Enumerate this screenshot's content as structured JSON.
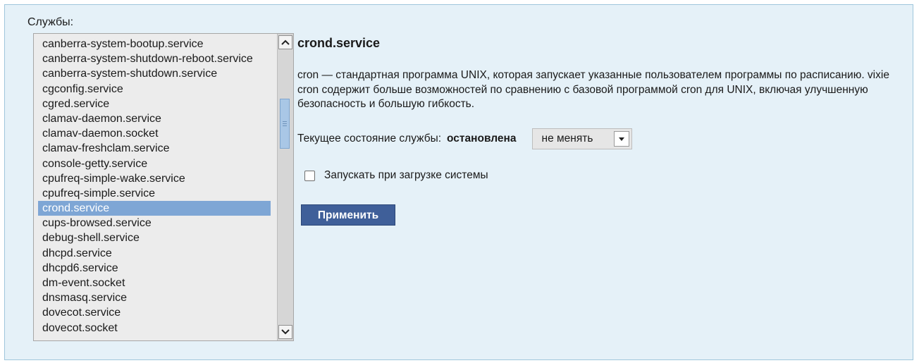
{
  "services_label": "Службы:",
  "services": [
    "canberra-system-bootup.service",
    "canberra-system-shutdown-reboot.service",
    "canberra-system-shutdown.service",
    "cgconfig.service",
    "cgred.service",
    "clamav-daemon.service",
    "clamav-daemon.socket",
    "clamav-freshclam.service",
    "console-getty.service",
    "cpufreq-simple-wake.service",
    "cpufreq-simple.service",
    "crond.service",
    "cups-browsed.service",
    "debug-shell.service",
    "dhcpd.service",
    "dhcpd6.service",
    "dm-event.socket",
    "dnsmasq.service",
    "dovecot.service",
    "dovecot.socket"
  ],
  "selected_service_index": 11,
  "detail": {
    "title": "crond.service",
    "description": "cron — стандартная программа UNIX, которая запускает указанные пользователем программы по расписанию. vixie cron содержит больше возможностей по сравнению с базовой программой cron для UNIX, включая улучшенную безопасность и большую гибкость.",
    "state_label": "Текущее состояние службы:",
    "state_value": "остановлена",
    "action_select": {
      "selected": "не менять"
    },
    "autostart_label": "Запускать при загрузке системы",
    "autostart_checked": false,
    "apply_label": "Применить"
  },
  "colors": {
    "panel_background": "#e5f1f8",
    "selection": "#7ea6d5",
    "apply_button": "#3f5f99"
  },
  "icons": {
    "scroll_up": "chevron-up-icon",
    "scroll_down": "chevron-down-icon",
    "select_arrow": "caret-down-icon"
  }
}
